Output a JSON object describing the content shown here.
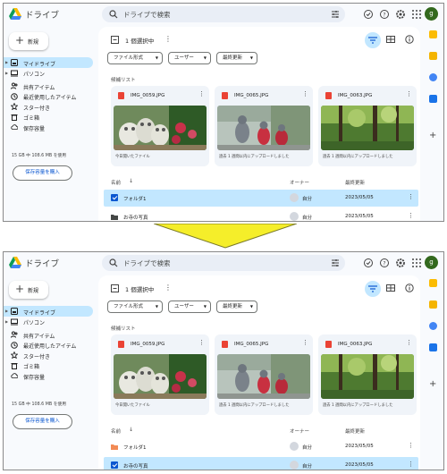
{
  "header": {
    "app_name": "ドライブ",
    "search_placeholder": "ドライブで検索",
    "avatar_letter": "g"
  },
  "nav": {
    "new_label": "新規",
    "items": [
      {
        "label": "マイドライブ",
        "icon": "my-drive-icon"
      },
      {
        "label": "パソコン",
        "icon": "computer-icon"
      },
      {
        "label": "共有アイテム",
        "icon": "shared-icon"
      },
      {
        "label": "最近使用したアイテム",
        "icon": "clock-icon"
      },
      {
        "label": "スター付き",
        "icon": "star-icon"
      },
      {
        "label": "ゴミ箱",
        "icon": "trash-icon"
      },
      {
        "label": "保存容量",
        "icon": "cloud-icon"
      }
    ],
    "storage_text": "15 GB 中 108.6 MB を使用",
    "buy_storage": "保存容量を購入"
  },
  "toolbar": {
    "selection_text": "1 個選択中"
  },
  "filters": {
    "file_type": "ファイル形式",
    "user": "ユーザー",
    "modified": "最終更新"
  },
  "suggested": {
    "label": "候補リスト",
    "cards": [
      {
        "name": "IMG_0059.JPG",
        "subtitle": "今日開いたファイル"
      },
      {
        "name": "IMG_0065.JPG",
        "subtitle": "過去 1 週間以内にアップロードしました"
      },
      {
        "name": "IMG_0063.JPG",
        "subtitle": "過去 1 週間以内にアップロードしました"
      }
    ]
  },
  "list": {
    "col_name": "名前",
    "col_owner": "オーナー",
    "col_modified": "最終更新",
    "rows": [
      {
        "name": "フォルダ1",
        "owner": "自分",
        "date": "2023/05/05"
      },
      {
        "name": "お寺の写真",
        "owner": "自分",
        "date": "2023/05/05"
      }
    ]
  },
  "colors": {
    "selected": "#c2e7ff",
    "accent": "#0b57d0",
    "folder": "#f28b55",
    "arrow": "#f5ee2a"
  }
}
